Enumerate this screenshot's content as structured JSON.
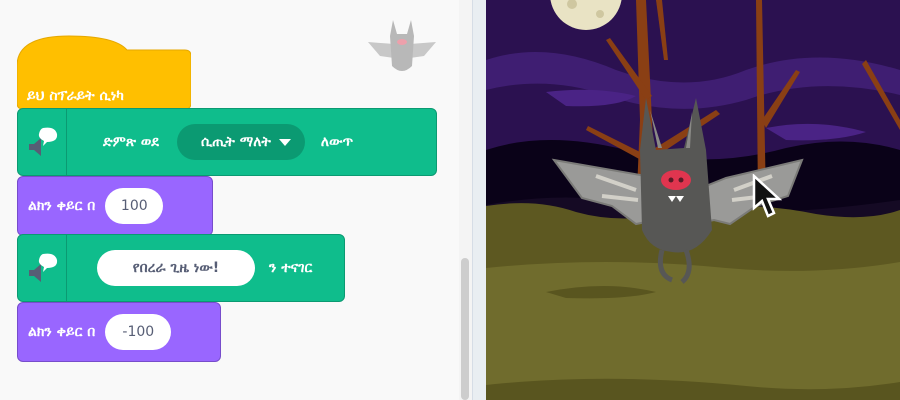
{
  "script": {
    "hat_block": {
      "label": "ይህ ስፕራይት ሲነካ"
    },
    "sound_block": {
      "prefix": "ድምጽ ወደ",
      "dropdown_value": "ሲጢት ማለት",
      "suffix": "ለውጥ"
    },
    "change_x_block_1": {
      "label": "ልክን ቀይር በ",
      "value": "100"
    },
    "say_block": {
      "message": "የበረራ ጊዜ ነው!",
      "suffix": "ን ተናገር"
    },
    "change_x_block_2": {
      "label": "ልክን ቀይር በ",
      "value": "-100"
    }
  },
  "colors": {
    "events": "#ffbf00",
    "sound": "#0fbd8c",
    "motion": "#9966ff",
    "stage_sky": "#2a0f4d",
    "stage_ground": "#5f5a22"
  },
  "icons": [
    "speaker-bubble-icon",
    "caret-down-icon",
    "mouse-pointer-icon",
    "bat-sprite-thumbnail"
  ]
}
